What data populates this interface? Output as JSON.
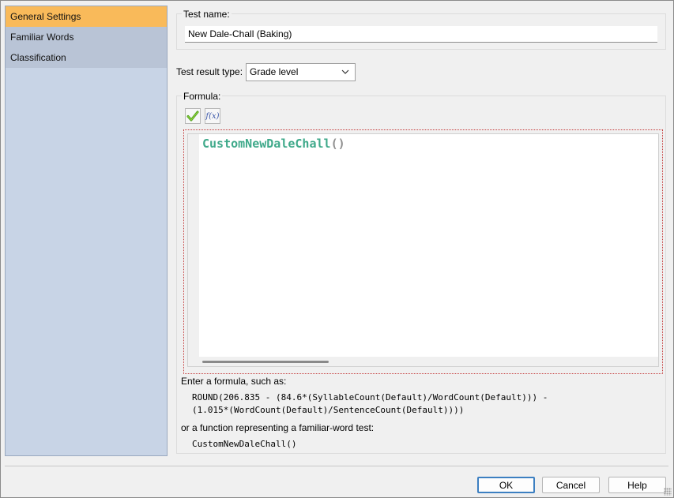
{
  "sidebar": {
    "items": [
      {
        "label": "General Settings",
        "selected": true
      },
      {
        "label": "Familiar Words",
        "selected": false
      },
      {
        "label": "Classification",
        "selected": false
      }
    ]
  },
  "test_name": {
    "label": "Test name:",
    "value": "New Dale-Chall (Baking)"
  },
  "result_type": {
    "label": "Test result type:",
    "selected": "Grade level"
  },
  "formula": {
    "label": "Formula:",
    "check_icon": "check-icon",
    "function_icon": "function-icon",
    "function_glyph": "f(x)",
    "code_name": "CustomNewDaleChall",
    "code_parens": "()",
    "hint_intro": "Enter a formula, such as:",
    "example_line1": "ROUND(206.835 - (84.6*(SyllableCount(Default)/WordCount(Default))) -",
    "example_line2": "(1.015*(WordCount(Default)/SentenceCount(Default))))",
    "hint_or": "or a function representing a familiar-word test:",
    "example_func": "CustomNewDaleChall()"
  },
  "buttons": {
    "ok": "OK",
    "cancel": "Cancel",
    "help": "Help"
  },
  "colors": {
    "selected_item": "#f9ba5a",
    "sidebar_bg": "#c8d4e6",
    "code_text": "#3fa98a",
    "editor_border": "#c43a3a",
    "default_button": "#3c7fc1"
  }
}
